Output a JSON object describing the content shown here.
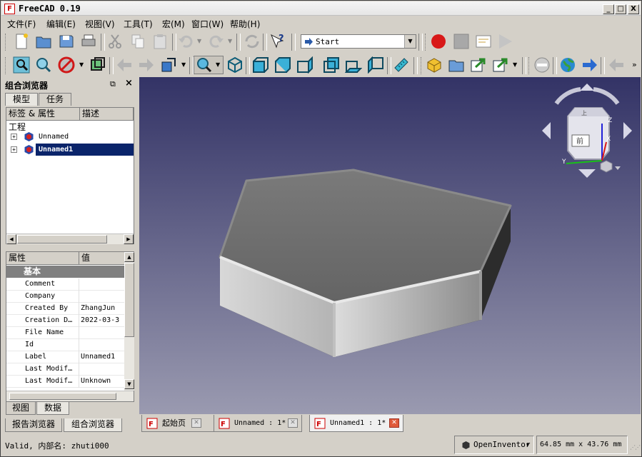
{
  "app": {
    "title": "FreeCAD 0.19",
    "logo_text": "F"
  },
  "window_buttons": {
    "minimize": "_",
    "maximize": "□",
    "close": "X"
  },
  "menu": [
    "文件(F)",
    "编辑(E)",
    "视图(V)",
    "工具(T)",
    "宏(M)",
    "窗口(W)",
    "帮助(H)"
  ],
  "toolbar": {
    "workbench": "Start"
  },
  "combo_view": {
    "title": "组合浏览器",
    "tabs": [
      "模型",
      "任务"
    ],
    "tree_headers": [
      "标签 & 属性",
      "描述"
    ],
    "root_label": "工程",
    "documents": [
      "Unnamed",
      "Unnamed1"
    ],
    "prop_headers": [
      "属性",
      "值"
    ],
    "group": "基本",
    "properties": [
      {
        "name": "Comment",
        "value": ""
      },
      {
        "name": "Company",
        "value": ""
      },
      {
        "name": "Created By",
        "value": "ZhangJun"
      },
      {
        "name": "Creation D…",
        "value": "2022-03-3"
      },
      {
        "name": "File Name",
        "value": ""
      },
      {
        "name": "Id",
        "value": ""
      },
      {
        "name": "Label",
        "value": "Unnamed1"
      },
      {
        "name": "Last Modif…",
        "value": ""
      },
      {
        "name": "Last Modif…",
        "value": "Unknown"
      }
    ],
    "prop_tabs": [
      "视图",
      "数据"
    ],
    "bottom_tabs": [
      "报告浏览器",
      "组合浏览器"
    ]
  },
  "navcube": {
    "front_label": "前",
    "top_label": "上",
    "axes": [
      "X",
      "Y",
      "Z"
    ]
  },
  "doc_tabs": [
    {
      "label": "起始页",
      "active": false
    },
    {
      "label": "Unnamed : 1*",
      "active": false
    },
    {
      "label": "Unnamed1 : 1*",
      "active": true
    }
  ],
  "status": {
    "message": "Valid, 内部名: zhuti000",
    "navigation": "OpenInventor",
    "dimensions": "64.85 mm x 43.76 mm"
  },
  "colors": {
    "selection": "#0a246a",
    "viewport_top": "#333366",
    "viewport_bottom": "#9a9ab0",
    "record": "#d81818"
  }
}
